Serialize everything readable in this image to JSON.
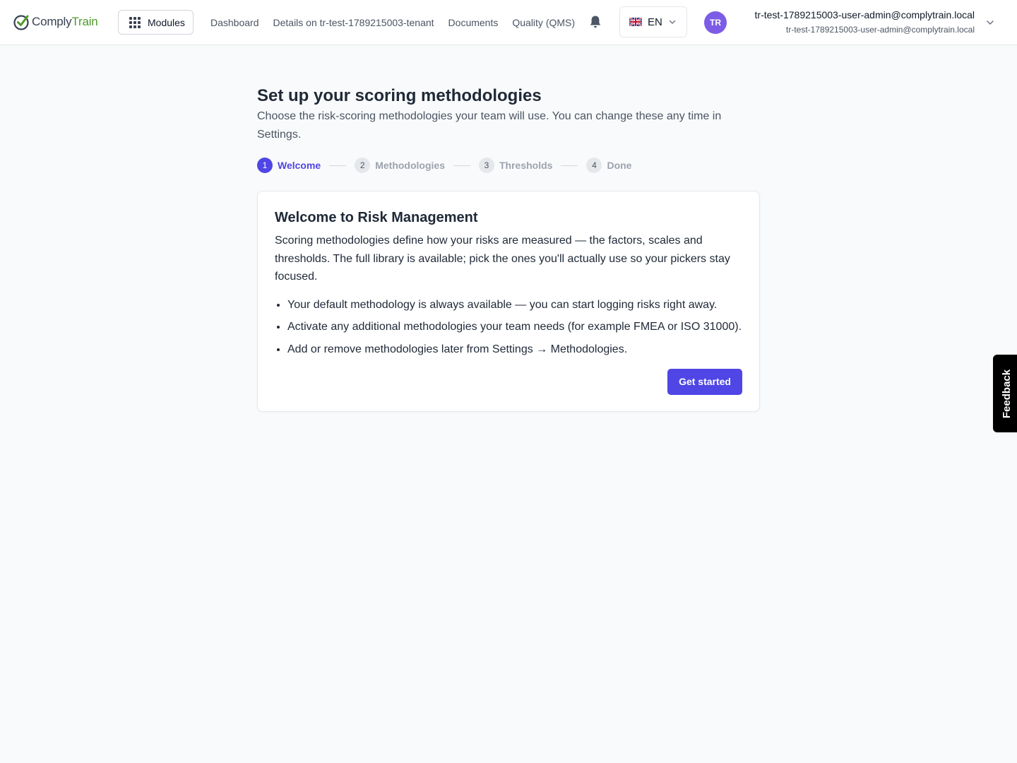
{
  "brand": {
    "part1": "Comply",
    "part2": "Train",
    "accent": "#4d9a2a"
  },
  "header": {
    "modules_label": "Modules",
    "nav": [
      "Dashboard",
      "Details on tr-test-1789215003-tenant",
      "Documents",
      "Quality (QMS)"
    ],
    "language": {
      "flag": "uk-flag-icon",
      "code": "EN"
    },
    "user": {
      "initials": "TR",
      "name": "tr-test-1789215003-user-admin@complytrain.local",
      "email": "tr-test-1789215003-user-admin@complytrain.local",
      "avatar_color": "#7c5ce6"
    }
  },
  "main": {
    "title": "Set up your scoring methodologies",
    "subtitle": "Choose the risk-scoring methodologies your team will use. You can change these any time in Settings.",
    "steps": [
      {
        "number": "1",
        "label": "Welcome",
        "active": true
      },
      {
        "number": "2",
        "label": "Methodologies",
        "active": false
      },
      {
        "number": "3",
        "label": "Thresholds",
        "active": false
      },
      {
        "number": "4",
        "label": "Done",
        "active": false
      }
    ],
    "card": {
      "title": "Welcome to Risk Management",
      "body": "Scoring methodologies define how your risks are measured — the factors, scales and thresholds. The full library is available; pick the ones you'll actually use so your pickers stay focused.",
      "bullets": [
        "Your default methodology is always available — you can start logging risks right away.",
        "Activate any additional methodologies your team needs (for example FMEA or ISO 31000).",
        "Add or remove methodologies later from Settings → Methodologies."
      ],
      "cta": "Get started"
    }
  },
  "feedback_label": "Feedback",
  "colors": {
    "primary": "#4f46e5",
    "background": "#f9fafb"
  }
}
